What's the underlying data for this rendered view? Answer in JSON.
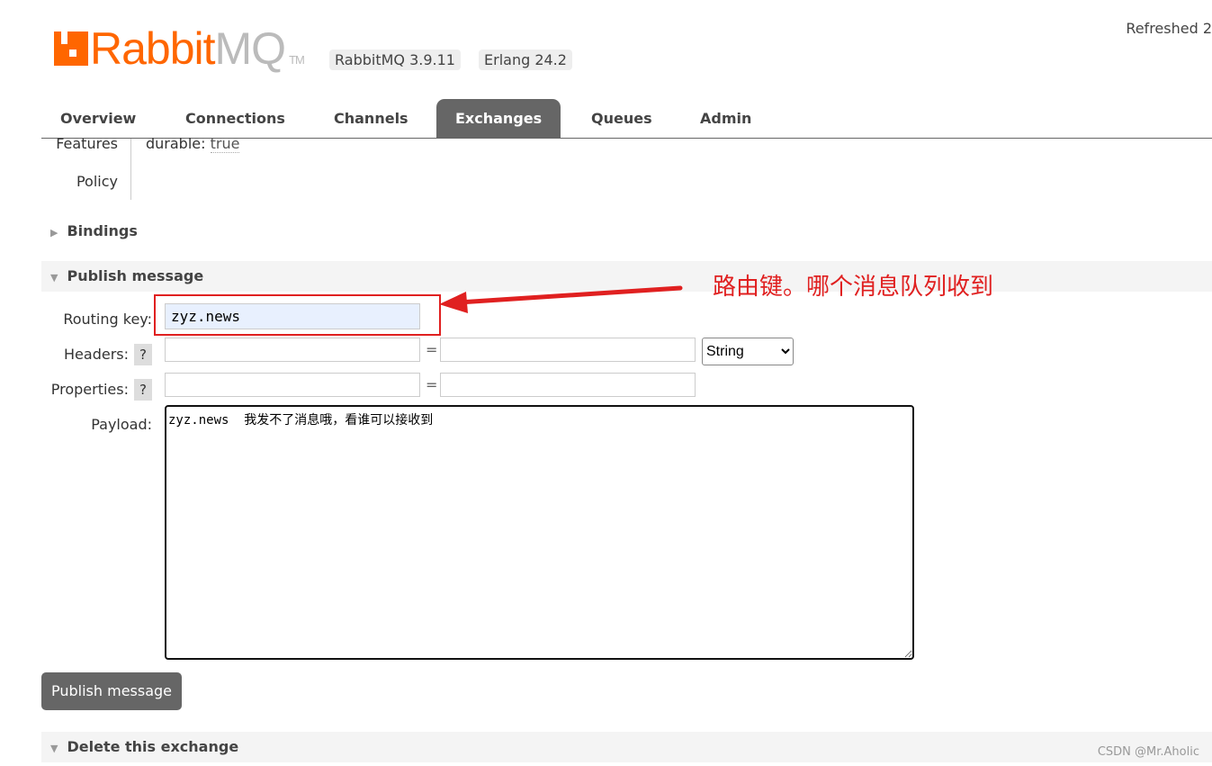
{
  "header": {
    "logo_text_brand": "Rabbit",
    "logo_text_mq": "MQ",
    "logo_tm": "TM",
    "version_badge": "RabbitMQ 3.9.11",
    "erlang_badge": "Erlang 24.2",
    "refreshed": "Refreshed 2"
  },
  "tabs": [
    {
      "label": "Overview"
    },
    {
      "label": "Connections"
    },
    {
      "label": "Channels"
    },
    {
      "label": "Exchanges",
      "active": true
    },
    {
      "label": "Queues"
    },
    {
      "label": "Admin"
    }
  ],
  "details": {
    "features_label": "Features",
    "features_key": "durable:",
    "features_value": "true",
    "policy_label": "Policy"
  },
  "bindings": {
    "title": "Bindings",
    "expanded": false
  },
  "publish": {
    "title": "Publish message",
    "routing_key_label": "Routing key:",
    "routing_key": "zyz.news",
    "headers_label": "Headers:",
    "properties_label": "Properties:",
    "help": "?",
    "equals": "=",
    "header_type": "String",
    "payload_label": "Payload:",
    "payload": "zyz.news  我发不了消息哦，看谁可以接收到",
    "button": "Publish message"
  },
  "delete": {
    "title": "Delete this exchange"
  },
  "annotation": {
    "text": "路由键。哪个消息队列收到",
    "color": "#e02020"
  },
  "watermark": "CSDN @Mr.Aholic",
  "colors": {
    "brand": "#ff6600",
    "tab_active": "#666666"
  }
}
